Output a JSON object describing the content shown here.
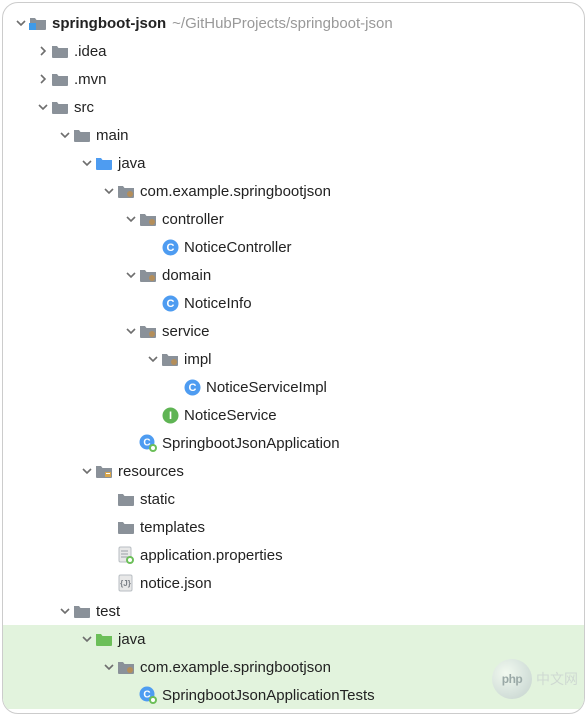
{
  "indentStep": 22,
  "baseIndent": 10,
  "rows": [
    {
      "depth": 0,
      "arrow": "down",
      "icon": "project-folder",
      "label": "springboot-json",
      "bold": true,
      "path": "~/GitHubProjects/springboot-json",
      "name": "project-root"
    },
    {
      "depth": 1,
      "arrow": "right",
      "icon": "folder",
      "label": ".idea",
      "name": "folder-idea"
    },
    {
      "depth": 1,
      "arrow": "right",
      "icon": "folder",
      "label": ".mvn",
      "name": "folder-mvn"
    },
    {
      "depth": 1,
      "arrow": "down",
      "icon": "folder",
      "label": "src",
      "name": "folder-src"
    },
    {
      "depth": 2,
      "arrow": "down",
      "icon": "folder",
      "label": "main",
      "name": "folder-main"
    },
    {
      "depth": 3,
      "arrow": "down",
      "icon": "source-folder",
      "label": "java",
      "name": "folder-java"
    },
    {
      "depth": 4,
      "arrow": "down",
      "icon": "package",
      "label": "com.example.springbootjson",
      "name": "package-root"
    },
    {
      "depth": 5,
      "arrow": "down",
      "icon": "package",
      "label": "controller",
      "name": "package-controller"
    },
    {
      "depth": 6,
      "arrow": "none",
      "icon": "class",
      "label": "NoticeController",
      "name": "class-noticecontroller"
    },
    {
      "depth": 5,
      "arrow": "down",
      "icon": "package",
      "label": "domain",
      "name": "package-domain"
    },
    {
      "depth": 6,
      "arrow": "none",
      "icon": "class",
      "label": "NoticeInfo",
      "name": "class-noticeinfo"
    },
    {
      "depth": 5,
      "arrow": "down",
      "icon": "package",
      "label": "service",
      "name": "package-service"
    },
    {
      "depth": 6,
      "arrow": "down",
      "icon": "package",
      "label": "impl",
      "name": "package-impl"
    },
    {
      "depth": 7,
      "arrow": "none",
      "icon": "class",
      "label": "NoticeServiceImpl",
      "name": "class-noticeserviceimpl"
    },
    {
      "depth": 6,
      "arrow": "none",
      "icon": "interface",
      "label": "NoticeService",
      "name": "interface-noticeservice"
    },
    {
      "depth": 5,
      "arrow": "none",
      "icon": "spring-class",
      "label": "SpringbootJsonApplication",
      "name": "class-springbootjsonapplication"
    },
    {
      "depth": 3,
      "arrow": "down",
      "icon": "resources-folder",
      "label": "resources",
      "name": "folder-resources"
    },
    {
      "depth": 4,
      "arrow": "none",
      "icon": "folder",
      "label": "static",
      "name": "folder-static"
    },
    {
      "depth": 4,
      "arrow": "none",
      "icon": "folder",
      "label": "templates",
      "name": "folder-templates"
    },
    {
      "depth": 4,
      "arrow": "none",
      "icon": "spring-props",
      "label": "application.properties",
      "name": "file-application-properties"
    },
    {
      "depth": 4,
      "arrow": "none",
      "icon": "json-file",
      "label": "notice.json",
      "name": "file-notice-json"
    },
    {
      "depth": 2,
      "arrow": "down",
      "icon": "folder",
      "label": "test",
      "name": "folder-test"
    },
    {
      "depth": 3,
      "arrow": "down",
      "icon": "test-folder",
      "label": "java",
      "name": "folder-test-java",
      "highlighted": true
    },
    {
      "depth": 4,
      "arrow": "down",
      "icon": "package",
      "label": "com.example.springbootjson",
      "name": "package-test-root",
      "highlighted": true
    },
    {
      "depth": 5,
      "arrow": "none",
      "icon": "spring-class",
      "label": "SpringbootJsonApplicationTests",
      "name": "class-springbootjsonapplicationtests",
      "highlighted": true
    }
  ],
  "watermark": {
    "logo": "php",
    "site": "中文网"
  }
}
